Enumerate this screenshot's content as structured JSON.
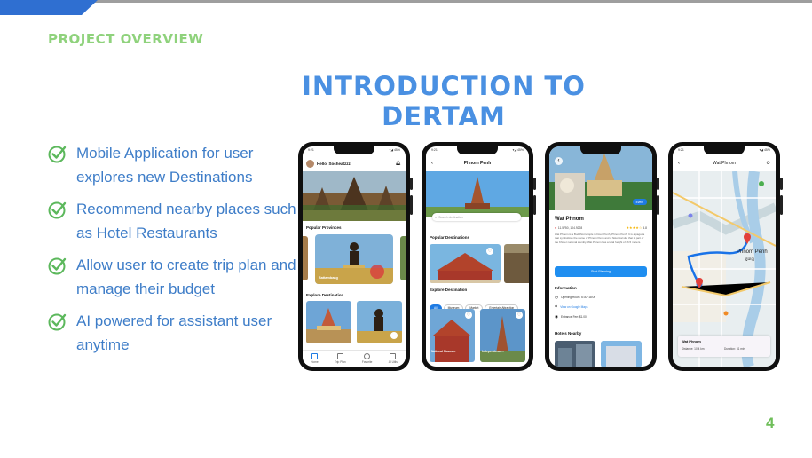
{
  "slide": {
    "kicker": "PROJECT OVERVIEW",
    "title": "INTRODUCTION TO DERTAM",
    "page_number": "4",
    "bullets": [
      "Mobile Application for user explores new Destinations",
      "Recommend nearby places such as Hotel Restaurants",
      "Allow user to create trip plan and manage their budget",
      "AI powered for assistant user anytime"
    ],
    "colors": {
      "kicker": "#8fd27c",
      "title": "#4a90e2",
      "bullet_text": "#3e7dc8",
      "check": "#5cb85c",
      "accent_bar": "#2f6fd1"
    }
  },
  "phones": {
    "home": {
      "status_time": "9:21",
      "status_right": "▾◢ 45%",
      "greeting": "Hello, Socheatzzz",
      "popular_provinces_label": "Popular Provinces",
      "province_card_label": "Battambang",
      "explore_destination_label": "Explore Destination",
      "nav": [
        "Home",
        "Trip Plan",
        "Favorite",
        "AI Utils"
      ]
    },
    "city": {
      "status_time": "9:21",
      "status_right": "▾◢ 45%",
      "header_title": "Phnom Penh",
      "search_placeholder": "Search destination",
      "popular_destinations_label": "Popular Destinations",
      "explore_destination_label": "Explore Destination",
      "filters": [
        "All",
        "Museum",
        "Market",
        "Entertain Attraction"
      ],
      "card1_label": "National Museum",
      "card2_label": "Independence..."
    },
    "detail": {
      "edit_label": "Event",
      "place_name": "Wat Phnom",
      "coords": "11.5750, 104.9228",
      "rating": "4.8",
      "description": "Wat Phnom is a Buddhist temple in Doun Penh, Phnom Penh. It is a pagoda that symbolizes the name of Phnom Penh and a historical site that is part of the Khmer national identity. Wat Phnom has a total height of 46.5 meters.",
      "start_button": "Start Planning",
      "info_label": "Information",
      "opening_hours": "Opening Hours: 6:30~18:00",
      "map_link": "View on Google Maps",
      "entrance_fee": "Entrance Fee: $1.00",
      "hotels_label": "Hotels Nearby"
    },
    "map": {
      "status_time": "9:21",
      "status_right": "▾◢ 45%",
      "header_title": "Wat Phnom",
      "city_label": "Phnom Penh",
      "city_khmer": "ភ្នំពេញ",
      "place_label": "Wat Phnom",
      "distance": "Distance: 10.4 km",
      "duration": "Duration: 31 min"
    }
  }
}
